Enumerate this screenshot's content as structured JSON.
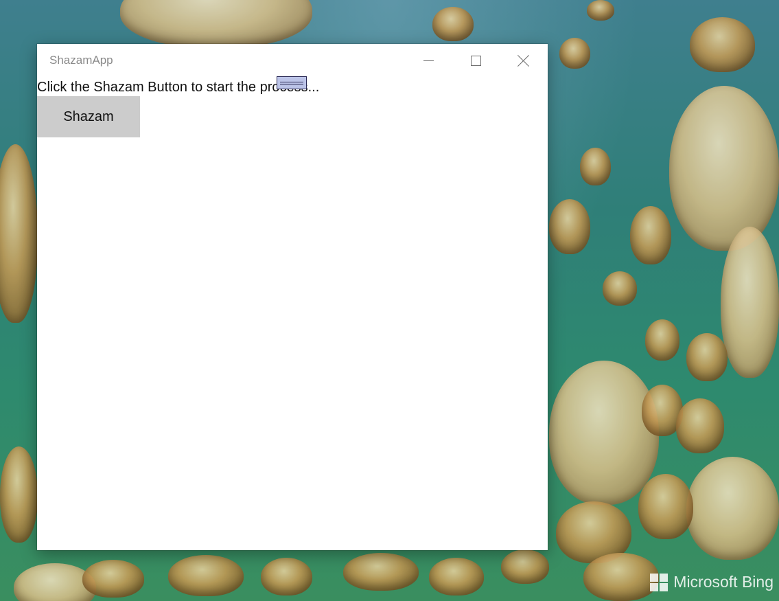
{
  "window": {
    "title": "ShazamApp"
  },
  "caption_buttons": {
    "minimize": "minimize-icon",
    "maximize": "maximize-icon",
    "close": "close-icon"
  },
  "content": {
    "prompt": "Click the Shazam Button to start the process...",
    "shazam_button_label": "Shazam"
  },
  "desktop": {
    "watermark": "Microsoft Bing"
  },
  "colors": {
    "button_background": "#cccccc",
    "title_text": "#8a8a8a",
    "drag_handle_fill": "#bcc4e8"
  }
}
